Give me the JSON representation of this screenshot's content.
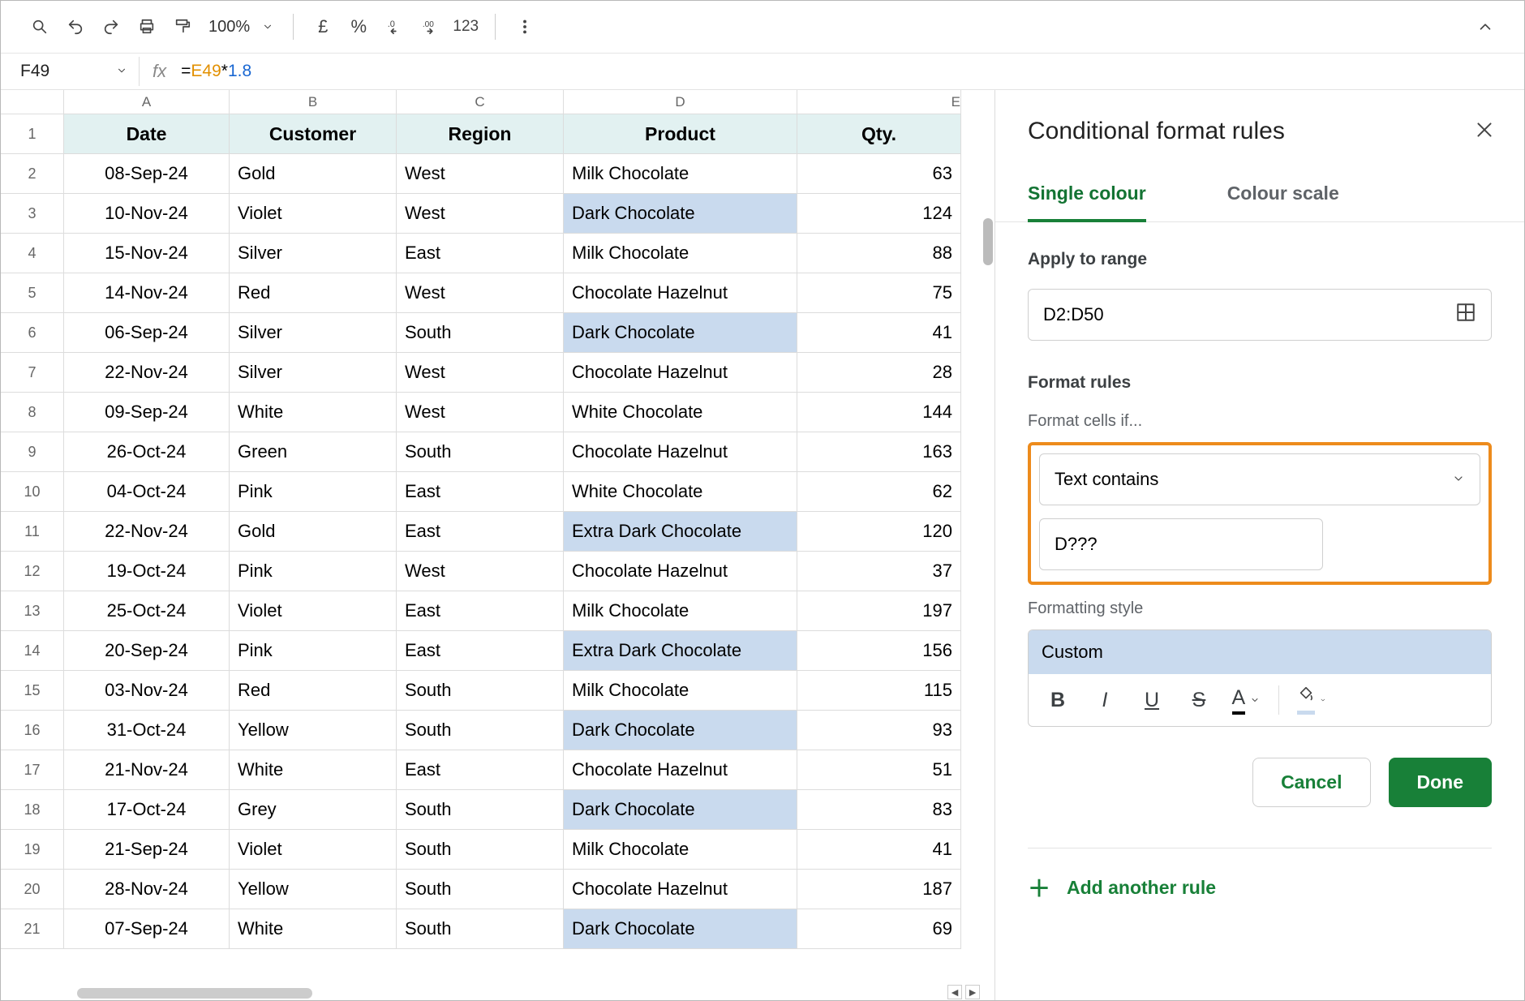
{
  "toolbar": {
    "zoom": "100%",
    "currency_symbol": "£",
    "percent": "%",
    "num_label": "123"
  },
  "namebox": {
    "ref": "F49"
  },
  "formula": {
    "eq": "=",
    "cell": "E49",
    "op": "*",
    "num": "1.8"
  },
  "columns": [
    "A",
    "B",
    "C",
    "D",
    "E"
  ],
  "headers": {
    "A": "Date",
    "B": "Customer",
    "C": "Region",
    "D": "Product",
    "E": "Qty."
  },
  "rows": [
    {
      "n": 1,
      "A": "Date",
      "B": "Customer",
      "C": "Region",
      "D": "Product",
      "E": "Qty.",
      "hdr": true
    },
    {
      "n": 2,
      "A": "08-Sep-24",
      "B": "Gold",
      "C": "West",
      "D": "Milk Chocolate",
      "E": "63"
    },
    {
      "n": 3,
      "A": "10-Nov-24",
      "B": "Violet",
      "C": "West",
      "D": "Dark Chocolate",
      "E": "124",
      "hlD": true
    },
    {
      "n": 4,
      "A": "15-Nov-24",
      "B": "Silver",
      "C": "East",
      "D": "Milk Chocolate",
      "E": "88"
    },
    {
      "n": 5,
      "A": "14-Nov-24",
      "B": "Red",
      "C": "West",
      "D": "Chocolate Hazelnut",
      "E": "75"
    },
    {
      "n": 6,
      "A": "06-Sep-24",
      "B": "Silver",
      "C": "South",
      "D": "Dark Chocolate",
      "E": "41",
      "hlD": true
    },
    {
      "n": 7,
      "A": "22-Nov-24",
      "B": "Silver",
      "C": "West",
      "D": "Chocolate Hazelnut",
      "E": "28"
    },
    {
      "n": 8,
      "A": "09-Sep-24",
      "B": "White",
      "C": "West",
      "D": "White Chocolate",
      "E": "144"
    },
    {
      "n": 9,
      "A": "26-Oct-24",
      "B": "Green",
      "C": "South",
      "D": "Chocolate Hazelnut",
      "E": "163"
    },
    {
      "n": 10,
      "A": "04-Oct-24",
      "B": "Pink",
      "C": "East",
      "D": "White Chocolate",
      "E": "62"
    },
    {
      "n": 11,
      "A": "22-Nov-24",
      "B": "Gold",
      "C": "East",
      "D": "Extra Dark Chocolate",
      "E": "120",
      "hlD": true
    },
    {
      "n": 12,
      "A": "19-Oct-24",
      "B": "Pink",
      "C": "West",
      "D": "Chocolate Hazelnut",
      "E": "37"
    },
    {
      "n": 13,
      "A": "25-Oct-24",
      "B": "Violet",
      "C": "East",
      "D": "Milk Chocolate",
      "E": "197"
    },
    {
      "n": 14,
      "A": "20-Sep-24",
      "B": "Pink",
      "C": "East",
      "D": "Extra Dark Chocolate",
      "E": "156",
      "hlD": true
    },
    {
      "n": 15,
      "A": "03-Nov-24",
      "B": "Red",
      "C": "South",
      "D": "Milk Chocolate",
      "E": "115"
    },
    {
      "n": 16,
      "A": "31-Oct-24",
      "B": "Yellow",
      "C": "South",
      "D": "Dark Chocolate",
      "E": "93",
      "hlD": true
    },
    {
      "n": 17,
      "A": "21-Nov-24",
      "B": "White",
      "C": "East",
      "D": "Chocolate Hazelnut",
      "E": "51"
    },
    {
      "n": 18,
      "A": "17-Oct-24",
      "B": "Grey",
      "C": "South",
      "D": "Dark Chocolate",
      "E": "83",
      "hlD": true
    },
    {
      "n": 19,
      "A": "21-Sep-24",
      "B": "Violet",
      "C": "South",
      "D": "Milk Chocolate",
      "E": "41"
    },
    {
      "n": 20,
      "A": "28-Nov-24",
      "B": "Yellow",
      "C": "South",
      "D": "Chocolate Hazelnut",
      "E": "187"
    },
    {
      "n": 21,
      "A": "07-Sep-24",
      "B": "White",
      "C": "South",
      "D": "Dark Chocolate",
      "E": "69",
      "hlD": true
    }
  ],
  "panel": {
    "title": "Conditional format rules",
    "tabs": {
      "single": "Single colour",
      "scale": "Colour scale"
    },
    "apply_label": "Apply to range",
    "range": "D2:D50",
    "rules_label": "Format rules",
    "cells_if": "Format cells if...",
    "condition": "Text contains",
    "value": "D???",
    "style_label": "Formatting style",
    "style_name": "Custom",
    "cancel": "Cancel",
    "done": "Done",
    "add": "Add another rule"
  }
}
